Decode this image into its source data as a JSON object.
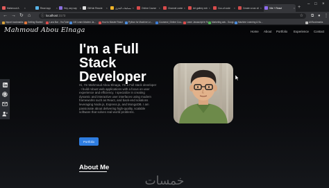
{
  "browser": {
    "tabs": [
      {
        "label": "Mahmoud A",
        "color": "#e25b5b"
      },
      {
        "label": "React app",
        "color": "#58b4e8"
      },
      {
        "label": "Hey, any say",
        "color": "#8a6ee0"
      },
      {
        "label": "GitHub Reacte",
        "color": "#dddddd"
      },
      {
        "label": "مسابقات البحري",
        "color": "#f0b429"
      },
      {
        "label": "Online Course",
        "color": "#d94c4c"
      },
      {
        "label": "Channel conte",
        "color": "#d94c4c"
      },
      {
        "label": "Art gallery exh",
        "color": "#d94c4c"
      },
      {
        "label": "Cus-of code",
        "color": "#d94c4c"
      },
      {
        "label": "Create a nav cli",
        "color": "#cf4d4d"
      },
      {
        "label": "Vite + React",
        "color": "#8f6bf0",
        "active": true
      }
    ],
    "url": "localhost",
    "url_port": ":3173",
    "bookmarks": [
      {
        "label": "Import bookmarks",
        "color": "#d8a33c"
      },
      {
        "label": "Getting Started",
        "color": "#e0763b"
      },
      {
        "label": "Luna Bar - YouTube",
        "color": "#d94c4c"
      },
      {
        "label": "100 Learn Modern Ja...",
        "color": "#4c8bd9"
      },
      {
        "label": "How to Master React",
        "color": "#d94c4c"
      },
      {
        "label": "Python for Machine Le...",
        "color": "#4c8bd9"
      },
      {
        "label": "Coursera | Online Cou...",
        "color": "#3c7bd4"
      },
      {
        "label": "Learn Javascript fe %...",
        "color": "#d94c4c"
      },
      {
        "label": "Marketing ads - Googl...",
        "color": "#4caf50"
      },
      {
        "label": "Machine Learning & Su...",
        "color": "#4c8bd9"
      }
    ],
    "all_bookmarks": "All Bookmarks"
  },
  "site": {
    "logo": "Mahmoud Abou Elnaga",
    "nav": [
      "Home",
      "About",
      "Portfolio",
      "Experience",
      "Contact"
    ],
    "hero": {
      "title": "I'm a Full Stack Developer",
      "description": "Hi, I'm Mahmoud Abou Elnaga, I'm a Full stack developer . I build robust web applications with a focus on user experience and efficiency. I specialize in creating dynamic and interactive user interfaces using modern frameworks such as React, and back-end solutions leveraging Node.js, Express.js, and MongoDB. I am passionate about delivering high-quality, scalable software that solves real-world problems.",
      "button": "Portfolio"
    },
    "about_title": "About Me",
    "social": [
      "linkedin-icon",
      "github-icon",
      "mail-icon",
      "contact-icon"
    ]
  },
  "watermark": "خمسات"
}
